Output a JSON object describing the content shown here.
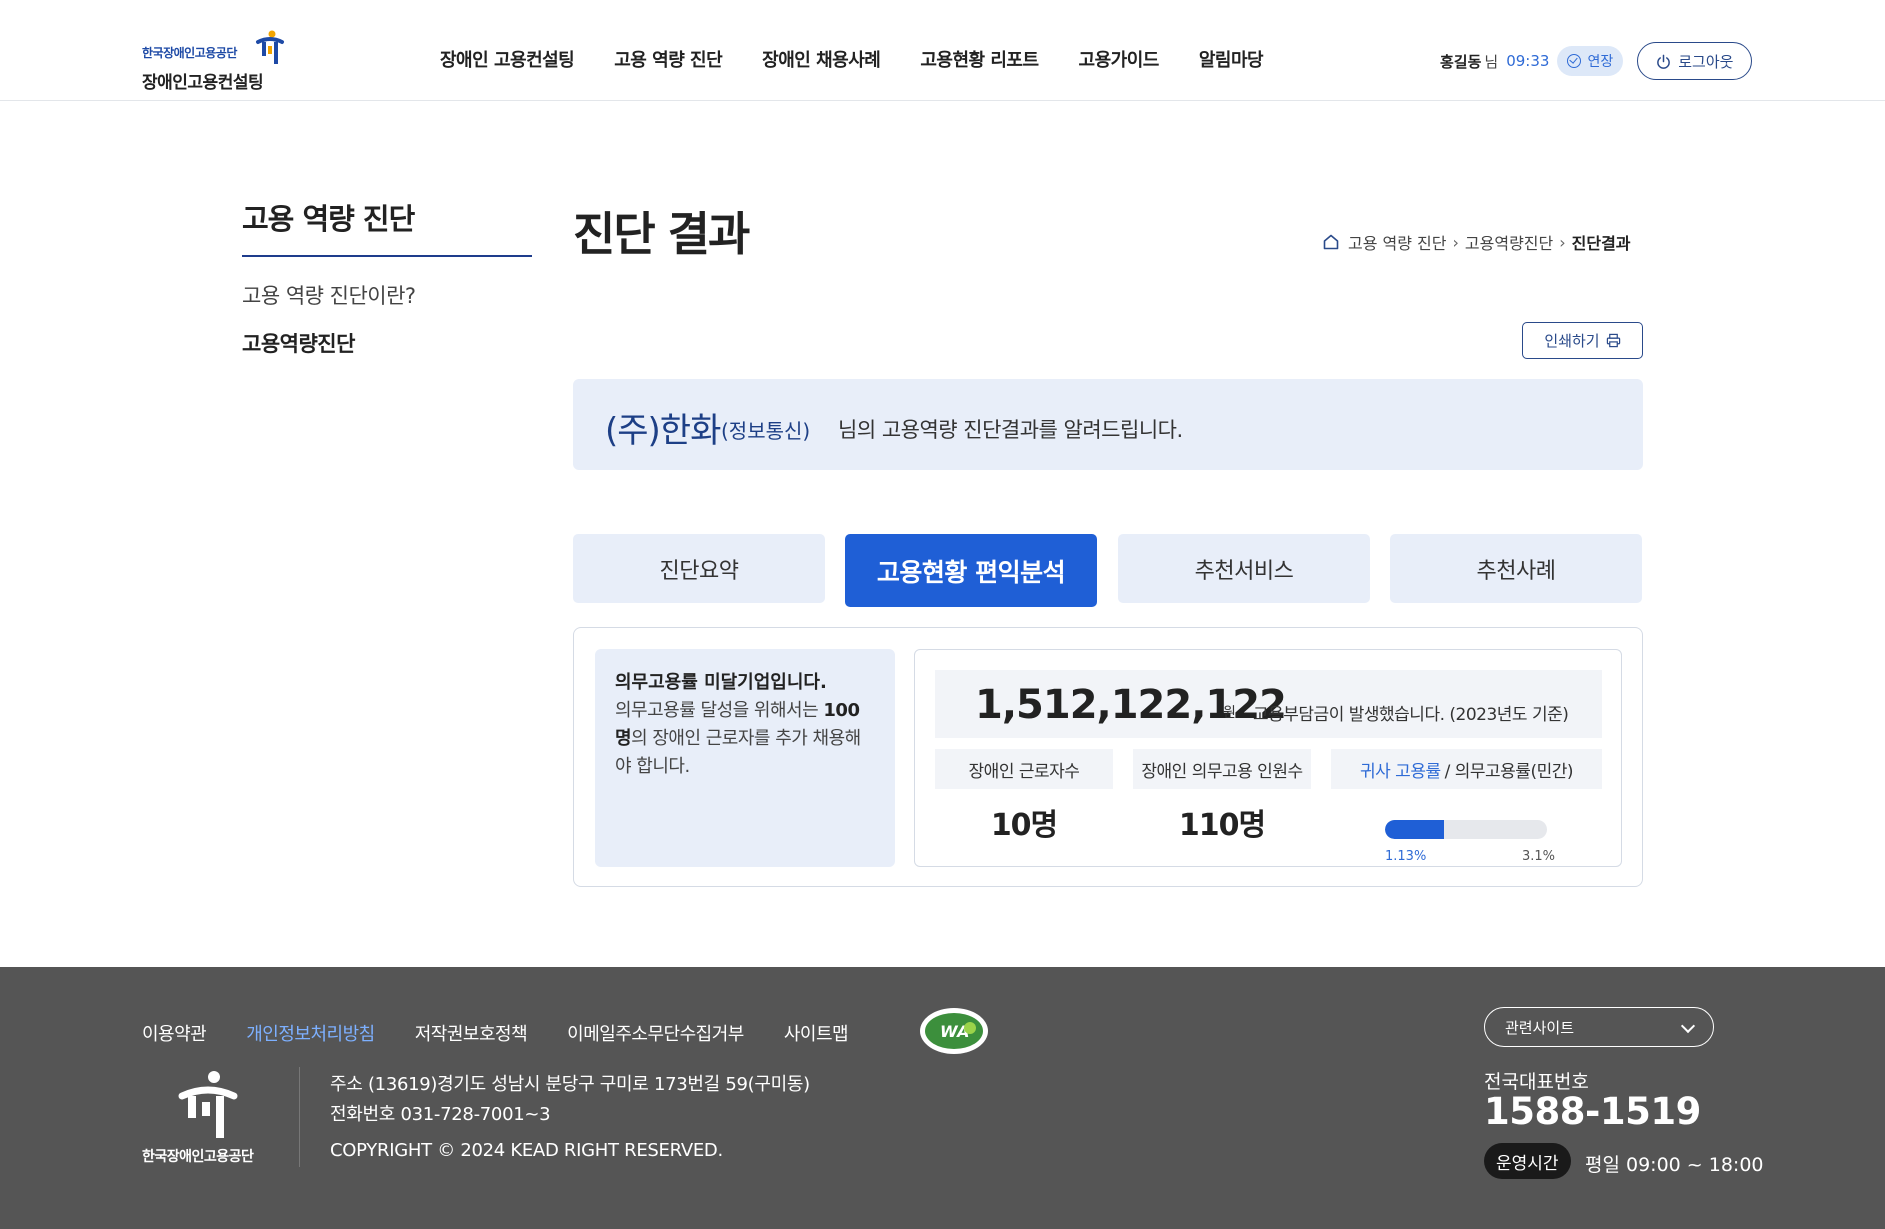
{
  "header": {
    "logo_top": "한국장애인고용공단",
    "logo_bottom": "장애인고용컨설팅",
    "nav": [
      "장애인 고용컨설팅",
      "고용 역량 진단",
      "장애인 채용사례",
      "고용현황 리포트",
      "고용가이드",
      "알림마당"
    ],
    "user_name": "홍길동",
    "user_suffix": "님",
    "session_time": "09:33",
    "extend_label": "연장",
    "logout_label": "로그아웃"
  },
  "sidebar": {
    "title": "고용 역량 진단",
    "items": [
      "고용 역량 진단이란?",
      "고용역량진단"
    ],
    "active_index": 1
  },
  "main": {
    "title": "진단 결과",
    "breadcrumb": [
      "고용 역량 진단",
      "고용역량진단",
      "진단결과"
    ],
    "print_label": "인쇄하기",
    "notice": {
      "company": "(주)한화",
      "dept": "(정보통신)",
      "text": "님의 고용역량 진단결과를 알려드립니다."
    },
    "tabs": [
      "진단요약",
      "고용현황 편익분석",
      "추천서비스",
      "추천사례"
    ],
    "active_tab": 1,
    "alert": {
      "title": "의무고용률 미달기업입니다.",
      "body_prefix": "의무고용률 달성을 위해서는 ",
      "body_count": "100",
      "body_unit": "명",
      "body_suffix": "의 장애인 근로자를 추가 채용해야 합니다."
    },
    "levy": {
      "amount": "1,512,122,122",
      "unit": "원",
      "text": "고용부담금이 발생했습니다. (2023년도 기준)"
    },
    "stats": {
      "label_workers": "장애인 근로자수",
      "label_quota": "장애인 의무고용 인원수",
      "label_rate_highlight": "귀사 고용률",
      "label_rate_rest": "/ 의무고용률(민간)",
      "workers": "10명",
      "quota": "110명",
      "rate_company": "1.13%",
      "rate_required": "3.1%",
      "rate_fraction": 0.3645
    }
  },
  "footer": {
    "links": [
      "이용약관",
      "개인정보처리방침",
      "저작권보호정책",
      "이메일주소무단수집거부",
      "사이트맵"
    ],
    "logo_text": "한국장애인고용공단",
    "address": "주소 (13619)경기도 성남시 분당구 구미로 173번길 59(구미동)",
    "phone": "전화번호 031-728-7001~3",
    "copyright": "COPYRIGHT © 2024 KEAD RIGHT RESERVED.",
    "related_label": "관련사이트",
    "rep_label": "전국대표번호",
    "rep_number": "1588-1519",
    "hours_badge": "운영시간",
    "hours_text": "평일 09:00 ~ 18:00",
    "wa_mark_text": "WA"
  },
  "colors": {
    "primary": "#1f5fd6",
    "navy": "#1d3f86",
    "light_bg": "#e8eef9",
    "footer_bg": "#555555",
    "link_blue": "#7db0ff"
  }
}
